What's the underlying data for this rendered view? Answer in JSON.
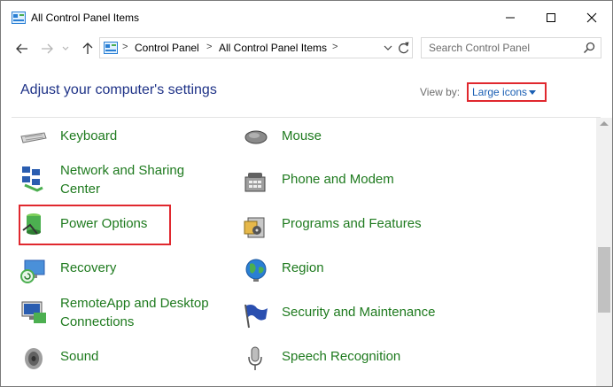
{
  "window": {
    "title": "All Control Panel Items",
    "controls": [
      "minimize-icon",
      "maximize-icon",
      "close-icon"
    ]
  },
  "nav": {
    "back_icon": "arrow-left-icon",
    "forward_icon": "arrow-right-icon",
    "recent_icon": "chevron-down-icon",
    "up_icon": "arrow-up-icon"
  },
  "address": {
    "crumbs": [
      "Control Panel",
      "All Control Panel Items"
    ],
    "separator": ">"
  },
  "search": {
    "placeholder": "Search Control Panel"
  },
  "header": {
    "title": "Adjust your computer's settings",
    "view_by_label": "View by:",
    "view_by_value": "Large icons"
  },
  "items": [
    {
      "label": "Keyboard",
      "icon": "keyboard-icon"
    },
    {
      "label": "Mouse",
      "icon": "mouse-icon"
    },
    {
      "label": "Network and Sharing\nCenter",
      "line1": "Network and Sharing",
      "line2": "Center",
      "icon": "network-icon"
    },
    {
      "label": "Phone and Modem",
      "icon": "phone-icon"
    },
    {
      "label": "Power Options",
      "icon": "power-icon"
    },
    {
      "label": "Programs and Features",
      "icon": "programs-icon"
    },
    {
      "label": "Recovery",
      "icon": "recovery-icon"
    },
    {
      "label": "Region",
      "icon": "globe-icon"
    },
    {
      "label": "RemoteApp and Desktop\nConnections",
      "line1": "RemoteApp and Desktop",
      "line2": "Connections",
      "icon": "remoteapp-icon"
    },
    {
      "label": "Security and Maintenance",
      "icon": "flag-icon"
    },
    {
      "label": "Sound",
      "icon": "speaker-icon"
    },
    {
      "label": "Speech Recognition",
      "icon": "microphone-icon"
    }
  ],
  "colors": {
    "link_green": "#1e7a1e",
    "heading_blue": "#1e3287",
    "highlight_red": "#e0282e"
  }
}
